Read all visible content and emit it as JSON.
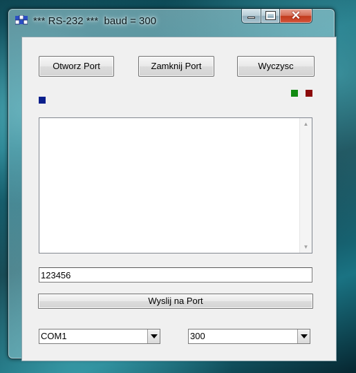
{
  "window": {
    "title": "*** RS-232 ***  baud = 300"
  },
  "toolbar": {
    "open_label": "Otworz Port",
    "close_label": "Zamknij Port",
    "clear_label": "Wyczysc"
  },
  "indicators": {
    "left_color": "#0a1f8c",
    "green_color": "#128a12",
    "red_color": "#8c0b0b"
  },
  "log": {
    "text": ""
  },
  "message": {
    "value": "123456"
  },
  "send": {
    "label": "Wyslij na Port"
  },
  "port_select": {
    "selected": "COM1"
  },
  "baud_select": {
    "selected": "300"
  }
}
